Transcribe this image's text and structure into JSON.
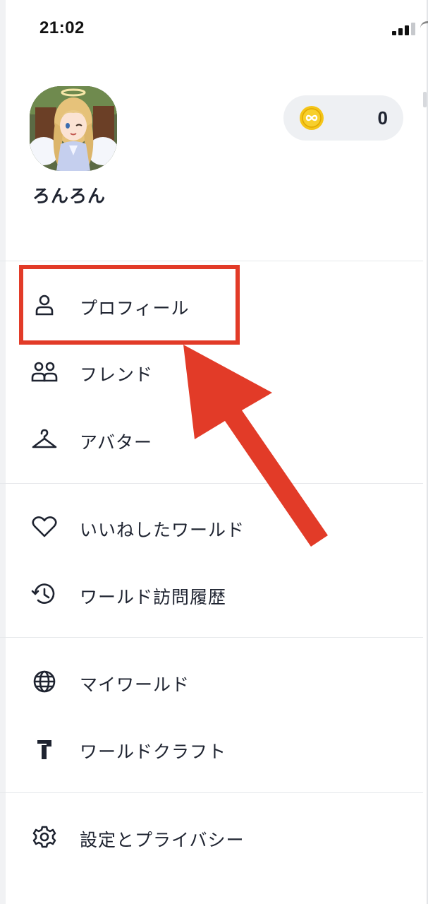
{
  "status_bar": {
    "time": "21:02"
  },
  "profile": {
    "name": "ろんろん",
    "coins": "0"
  },
  "menu": {
    "profile": "プロフィール",
    "friends": "フレンド",
    "avatar": "アバター",
    "liked_worlds": "いいねしたワールド",
    "world_history": "ワールド訪問履歴",
    "my_worlds": "マイワールド",
    "world_craft": "ワールドクラフト",
    "settings": "設定とプライバシー"
  },
  "icons": {
    "profile": "person-icon",
    "friends": "friends-icon",
    "avatar": "hanger-icon",
    "liked_worlds": "heart-icon",
    "world_history": "history-icon",
    "my_worlds": "globe-icon",
    "world_craft": "hammer-icon",
    "settings": "gear-icon",
    "coin": "coin-icon"
  },
  "colors": {
    "highlight": "#e23b28",
    "text": "#1e2330",
    "coin": "#f5c518",
    "pill_bg": "#eef0f3"
  }
}
